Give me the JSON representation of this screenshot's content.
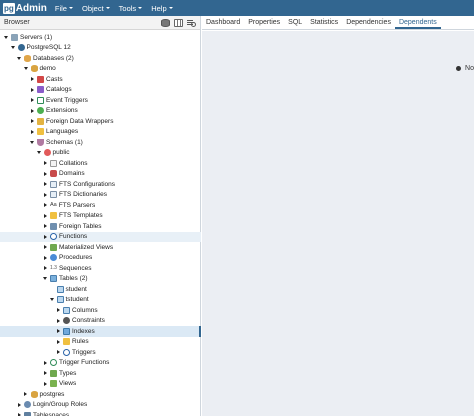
{
  "app": {
    "logo_pg": "pg",
    "logo_admin": "Admin"
  },
  "menu": [
    "File",
    "Object",
    "Tools",
    "Help"
  ],
  "browser": {
    "title": "Browser"
  },
  "tree": [
    {
      "label": "Servers (1)",
      "depth": 0,
      "toggle": "open",
      "icon": "server"
    },
    {
      "label": "PostgreSQL 12",
      "depth": 1,
      "toggle": "open",
      "icon": "pg"
    },
    {
      "label": "Databases (2)",
      "depth": 2,
      "toggle": "open",
      "icon": "dbs"
    },
    {
      "label": "demo",
      "depth": 3,
      "toggle": "open",
      "icon": "db"
    },
    {
      "label": "Casts",
      "depth": 4,
      "toggle": "closed",
      "icon": "cast"
    },
    {
      "label": "Catalogs",
      "depth": 4,
      "toggle": "closed",
      "icon": "catalog"
    },
    {
      "label": "Event Triggers",
      "depth": 4,
      "toggle": "closed",
      "icon": "trigger"
    },
    {
      "label": "Extensions",
      "depth": 4,
      "toggle": "closed",
      "icon": "ext"
    },
    {
      "label": "Foreign Data Wrappers",
      "depth": 4,
      "toggle": "closed",
      "icon": "fdw"
    },
    {
      "label": "Languages",
      "depth": 4,
      "toggle": "closed",
      "icon": "folder"
    },
    {
      "label": "Schemas (1)",
      "depth": 4,
      "toggle": "open",
      "icon": "schemas"
    },
    {
      "label": "public",
      "depth": 5,
      "toggle": "open",
      "icon": "public"
    },
    {
      "label": "Collations",
      "depth": 6,
      "toggle": "closed",
      "icon": "coll"
    },
    {
      "label": "Domains",
      "depth": 6,
      "toggle": "closed",
      "icon": "domain"
    },
    {
      "label": "FTS Configurations",
      "depth": 6,
      "toggle": "closed",
      "icon": "fts"
    },
    {
      "label": "FTS Dictionaries",
      "depth": 6,
      "toggle": "closed",
      "icon": "fts"
    },
    {
      "label": "FTS Parsers",
      "depth": 6,
      "toggle": "closed",
      "icon": "fts-parser",
      "glyph": "Aa"
    },
    {
      "label": "FTS Templates",
      "depth": 6,
      "toggle": "closed",
      "icon": "fts-tmpl"
    },
    {
      "label": "Foreign Tables",
      "depth": 6,
      "toggle": "closed",
      "icon": "ftable"
    },
    {
      "label": "Functions",
      "depth": 6,
      "toggle": "closed",
      "icon": "func",
      "highlight": true
    },
    {
      "label": "Materialized Views",
      "depth": 6,
      "toggle": "closed",
      "icon": "mview"
    },
    {
      "label": "Procedures",
      "depth": 6,
      "toggle": "closed",
      "icon": "proc"
    },
    {
      "label": "Sequences",
      "depth": 6,
      "toggle": "closed",
      "icon": "seq",
      "glyph": "1.3"
    },
    {
      "label": "Tables (2)",
      "depth": 6,
      "toggle": "open",
      "icon": "tables"
    },
    {
      "label": "student",
      "depth": 7,
      "toggle": "none",
      "icon": "table"
    },
    {
      "label": "tstudent",
      "depth": 7,
      "toggle": "open",
      "icon": "table"
    },
    {
      "label": "Columns",
      "depth": 8,
      "toggle": "closed",
      "icon": "col"
    },
    {
      "label": "Constraints",
      "depth": 8,
      "toggle": "closed",
      "icon": "cons"
    },
    {
      "label": "Indexes",
      "depth": 8,
      "toggle": "closed",
      "icon": "idx",
      "selected": true
    },
    {
      "label": "Rules",
      "depth": 8,
      "toggle": "closed",
      "icon": "rules"
    },
    {
      "label": "Triggers",
      "depth": 8,
      "toggle": "closed",
      "icon": "trig2"
    },
    {
      "label": "Trigger Functions",
      "depth": 6,
      "toggle": "closed",
      "icon": "tfunc"
    },
    {
      "label": "Types",
      "depth": 6,
      "toggle": "closed",
      "icon": "types"
    },
    {
      "label": "Views",
      "depth": 6,
      "toggle": "closed",
      "icon": "views"
    },
    {
      "label": "postgres",
      "depth": 3,
      "toggle": "closed",
      "icon": "db"
    },
    {
      "label": "Login/Group Roles",
      "depth": 2,
      "toggle": "closed",
      "icon": "role"
    },
    {
      "label": "Tablespaces",
      "depth": 2,
      "toggle": "closed",
      "icon": "tbs"
    }
  ],
  "tabs": [
    "Dashboard",
    "Properties",
    "SQL",
    "Statistics",
    "Dependencies",
    "Dependents"
  ],
  "active_tab": "Dependents",
  "content": {
    "message": "No"
  },
  "colors": {
    "navbar": "#326690",
    "panel": "#ebeef3",
    "selected": "#dbe9f5"
  }
}
